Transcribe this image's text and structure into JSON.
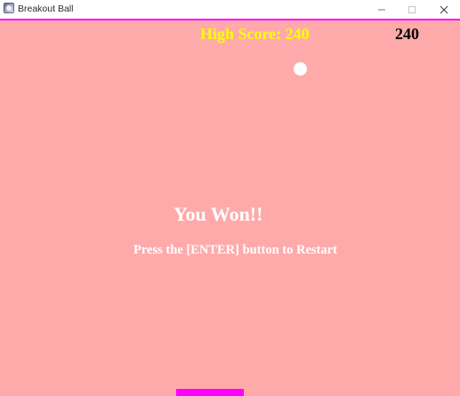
{
  "window": {
    "title": "Breakout Ball",
    "icon": "app-icon",
    "controls": [
      "minimize-icon",
      "maximize-icon",
      "close-icon"
    ]
  },
  "game": {
    "high_score_label": "High Score: 240",
    "score": "240",
    "win_message": "You Won!!",
    "restart_message": "Press the [ENTER] button to Restart"
  },
  "colors": {
    "background": "#ffaaaa",
    "accent": "#ff00ff",
    "high_score": "#ffff00",
    "score": "#000000",
    "message": "#ffffff",
    "ball": "#ffffff",
    "paddle": "#ff00ff"
  }
}
